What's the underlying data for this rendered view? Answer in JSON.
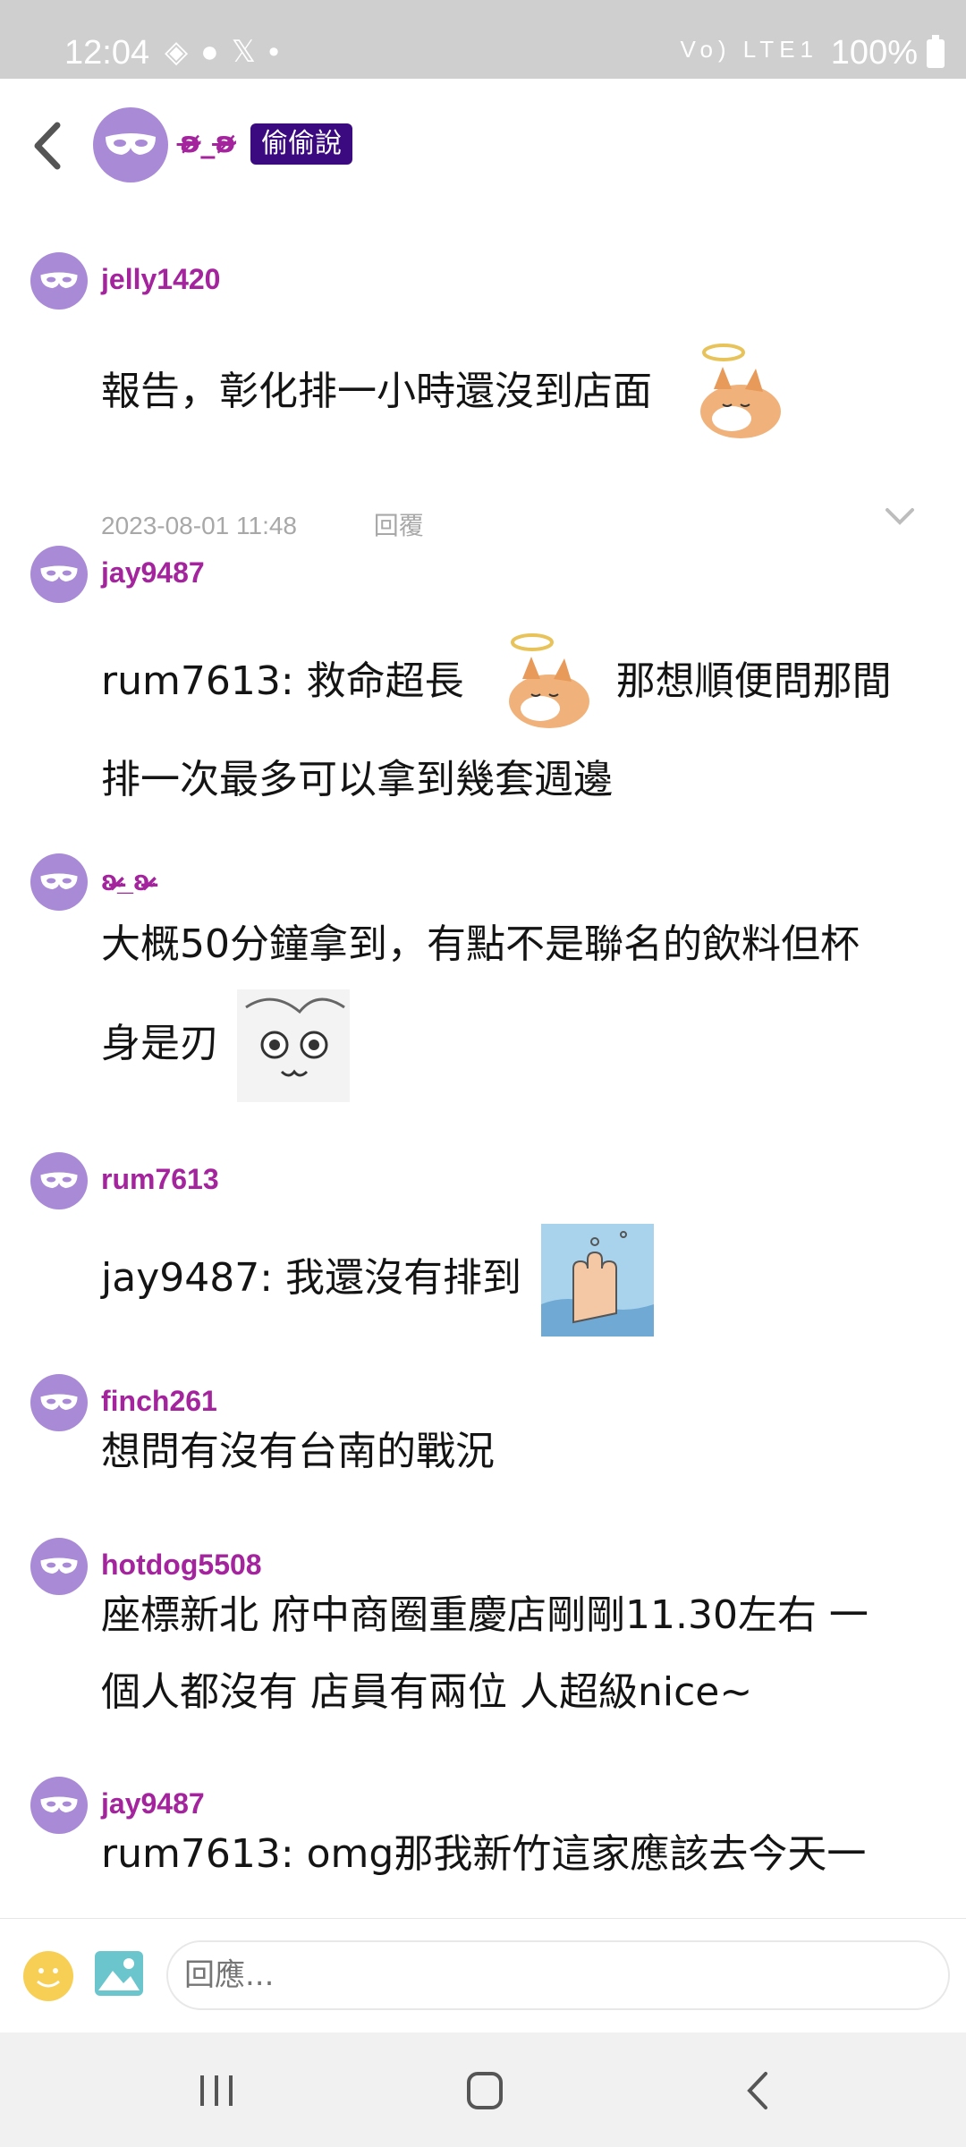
{
  "status_bar": {
    "time": "12:04",
    "battery": "100%",
    "network": "Vo) LTE1"
  },
  "header": {
    "author": "ʚ̴̶̷̷_ʚ̴̶̷̷",
    "badge": "偷偷說"
  },
  "comments": [
    {
      "username": "jelly1420",
      "text": "報告，彰化排一小時還沒到店面",
      "timestamp": "2023-08-01 11:48",
      "reply_label": "回覆"
    },
    {
      "username": "jay9487",
      "text_a": "rum7613: 救命超長",
      "text_b": "那想順便問那間",
      "text_c": "排一次最多可以拿到幾套週邊"
    },
    {
      "username": "ʚ̴̶̷̷_ʚ̴̶̷̷",
      "text_a": "大概50分鐘拿到，有點不是聯名的飲料但杯",
      "text_b": "身是刃"
    },
    {
      "username": "rum7613",
      "text": "jay9487: 我還沒有排到"
    },
    {
      "username": "finch261",
      "text": "想問有沒有台南的戰況"
    },
    {
      "username": "hotdog5508",
      "text_a": "座標新北 府中商圈重慶店剛剛11.30左右 一",
      "text_b": "個人都沒有 店員有兩位 人超級nice~"
    },
    {
      "username": "jay9487",
      "text": "rum7613: omg那我新竹這家應該去今天一"
    }
  ],
  "input": {
    "placeholder": "回應..."
  },
  "colors": {
    "username": "#a3249d",
    "avatar": "#a98ad6",
    "badge_bg": "#3b0a80"
  }
}
